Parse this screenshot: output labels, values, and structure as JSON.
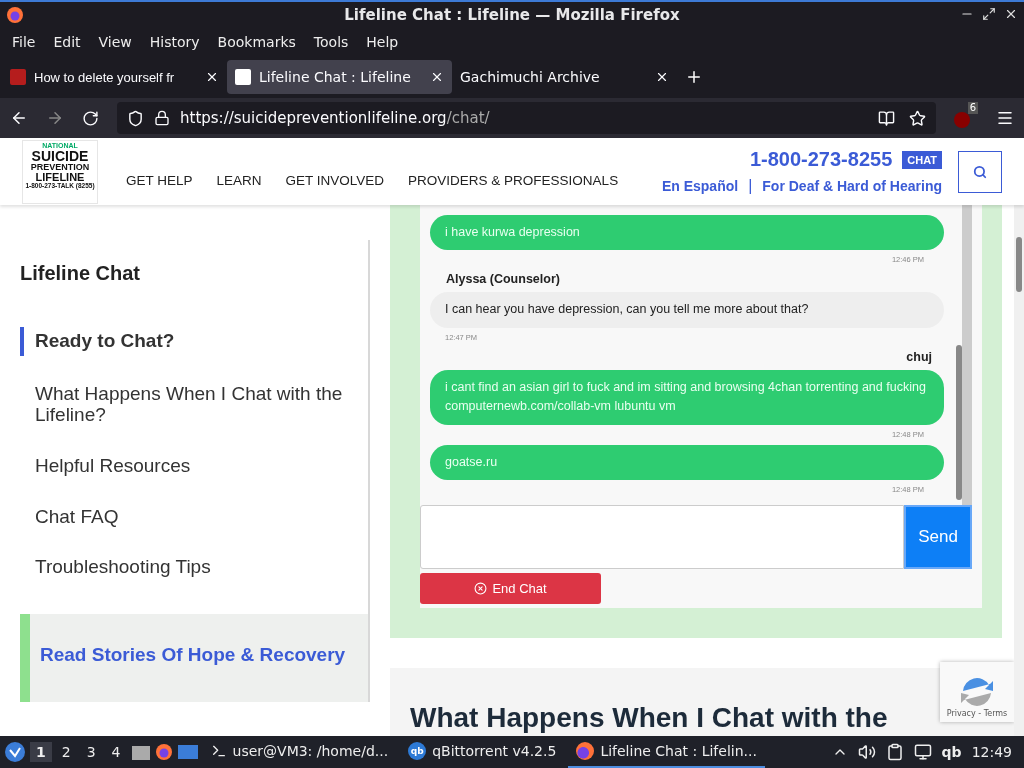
{
  "window": {
    "title": "Lifeline Chat : Lifeline — Mozilla Firefox"
  },
  "menu": [
    "File",
    "Edit",
    "View",
    "History",
    "Bookmarks",
    "Tools",
    "Help"
  ],
  "tabs": [
    {
      "label": "How to delete yourself fr",
      "selected": false
    },
    {
      "label": "Lifeline Chat : Lifeline",
      "selected": true
    },
    {
      "label": "Gachimuchi Archive",
      "selected": false
    }
  ],
  "address": {
    "host": "https://suicidepreventionlifeline.org",
    "path": "/chat/"
  },
  "extension_badge": "6",
  "site_header": {
    "logo": {
      "top": "NATIONAL",
      "line1": "SUICIDE",
      "line2": "PREVENTION",
      "line3": "LIFELINE",
      "phone": "1-800-273-TALK (8255)"
    },
    "nav": [
      "GET HELP",
      "LEARN",
      "GET INVOLVED",
      "PROVIDERS & PROFESSIONALS"
    ],
    "phone": "1-800-273-8255",
    "chat_badge": "CHAT",
    "links": [
      "En Español",
      "For Deaf & Hard of Hearing"
    ],
    "link_separator": "|"
  },
  "sidebar": {
    "title": "Lifeline Chat",
    "items": [
      {
        "label": "Ready to Chat?",
        "selected": true
      },
      {
        "label": "What Happens When I Chat with the Lifeline?",
        "selected": false
      },
      {
        "label": "Helpful Resources",
        "selected": false
      },
      {
        "label": "Chat FAQ",
        "selected": false
      },
      {
        "label": "Troubleshooting Tips",
        "selected": false
      }
    ],
    "story": "Read Stories Of Hope & Recovery"
  },
  "chat": {
    "messages": [
      {
        "kind": "user",
        "text": "i have kurwa depression",
        "time": "12:46 PM"
      },
      {
        "kind": "counselor",
        "sender": "Alyssa (Counselor)",
        "text": "I can hear you have depression, can you tell me more about that?",
        "time": "12:47 PM"
      },
      {
        "kind": "user",
        "sender": "chuj",
        "text": "i cant find an asian girl to fuck and im sitting and browsing 4chan torrenting and fucking computernewb.com/collab-vm lubuntu vm",
        "time": "12:48 PM"
      },
      {
        "kind": "user",
        "text": "goatse.ru",
        "time": "12:48 PM"
      }
    ],
    "send": "Send",
    "end": "End Chat"
  },
  "section_heading": "What Happens When I Chat with the",
  "recaptcha": "Privacy - Terms",
  "taskbar": {
    "workspaces": [
      {
        "label": "1",
        "selected": true
      },
      {
        "label": "2",
        "selected": false
      },
      {
        "label": "3",
        "selected": false
      },
      {
        "label": "4",
        "selected": false
      }
    ],
    "tasks": [
      {
        "kind": "terminal",
        "label": "user@VM3: /home/d...",
        "selected": false
      },
      {
        "kind": "qbittorrent",
        "icon_text": "qb",
        "label": "qBittorrent v4.2.5",
        "selected": false
      },
      {
        "kind": "firefox",
        "label": "Lifeline Chat : Lifelin...",
        "selected": true
      }
    ],
    "tray_qb": "qb",
    "clock": "12:49"
  }
}
